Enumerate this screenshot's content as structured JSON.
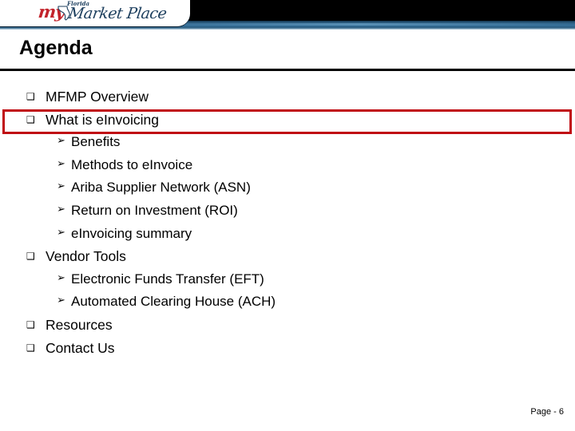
{
  "header": {
    "logo": {
      "my_text": "my",
      "florida_text": "Florida",
      "market_text": "Market Place",
      "state_icon": "florida-state-outline-icon",
      "colors": {
        "my": "#c3232b",
        "market": "#1d3f5e",
        "band_top": "#000000",
        "band_blue": "#36709a"
      }
    }
  },
  "slide": {
    "title": "Agenda",
    "items": [
      {
        "level": 1,
        "marker": "❑",
        "text": "MFMP Overview"
      },
      {
        "level": 1,
        "marker": "❑",
        "text": "What is eInvoicing",
        "highlighted": true
      },
      {
        "level": 2,
        "marker": "➢",
        "text": "Benefits"
      },
      {
        "level": 2,
        "marker": "➢",
        "text": "Methods to eInvoice"
      },
      {
        "level": 2,
        "marker": "➢",
        "text": "Ariba Supplier Network (ASN)"
      },
      {
        "level": 2,
        "marker": "➢",
        "text": "Return on Investment (ROI)"
      },
      {
        "level": 2,
        "marker": "➢",
        "text": "eInvoicing summary"
      },
      {
        "level": 1,
        "marker": "❑",
        "text": "Vendor Tools"
      },
      {
        "level": 2,
        "marker": "➢",
        "text": "Electronic Funds Transfer (EFT)"
      },
      {
        "level": 2,
        "marker": "➢",
        "text": "Automated Clearing House (ACH)"
      },
      {
        "level": 1,
        "marker": "❑",
        "text": "Resources"
      },
      {
        "level": 1,
        "marker": "❑",
        "text": "Contact Us"
      }
    ],
    "highlight_color": "#c00b12"
  },
  "footer": {
    "page_label": "Page - 6"
  }
}
